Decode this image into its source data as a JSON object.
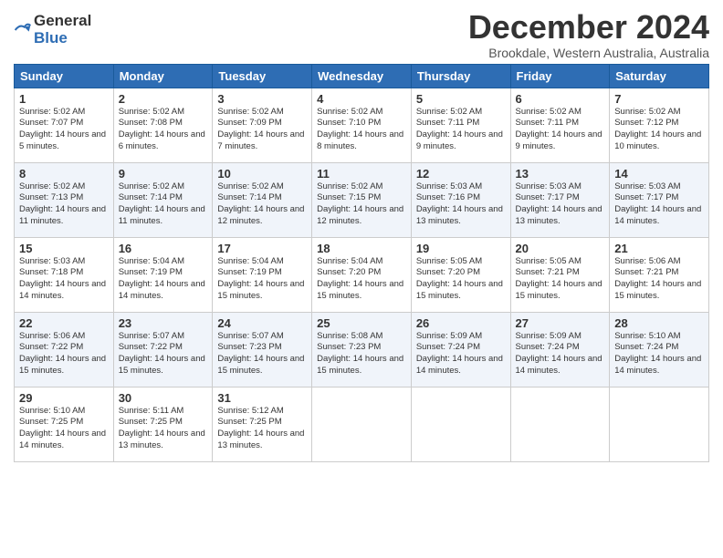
{
  "header": {
    "logo_line1": "General",
    "logo_line2": "Blue",
    "title": "December 2024",
    "subtitle": "Brookdale, Western Australia, Australia"
  },
  "days_of_week": [
    "Sunday",
    "Monday",
    "Tuesday",
    "Wednesday",
    "Thursday",
    "Friday",
    "Saturday"
  ],
  "weeks": [
    [
      {
        "day": "1",
        "sunrise": "5:02 AM",
        "sunset": "7:07 PM",
        "daylight": "14 hours and 5 minutes."
      },
      {
        "day": "2",
        "sunrise": "5:02 AM",
        "sunset": "7:08 PM",
        "daylight": "14 hours and 6 minutes."
      },
      {
        "day": "3",
        "sunrise": "5:02 AM",
        "sunset": "7:09 PM",
        "daylight": "14 hours and 7 minutes."
      },
      {
        "day": "4",
        "sunrise": "5:02 AM",
        "sunset": "7:10 PM",
        "daylight": "14 hours and 8 minutes."
      },
      {
        "day": "5",
        "sunrise": "5:02 AM",
        "sunset": "7:11 PM",
        "daylight": "14 hours and 9 minutes."
      },
      {
        "day": "6",
        "sunrise": "5:02 AM",
        "sunset": "7:11 PM",
        "daylight": "14 hours and 9 minutes."
      },
      {
        "day": "7",
        "sunrise": "5:02 AM",
        "sunset": "7:12 PM",
        "daylight": "14 hours and 10 minutes."
      }
    ],
    [
      {
        "day": "8",
        "sunrise": "5:02 AM",
        "sunset": "7:13 PM",
        "daylight": "14 hours and 11 minutes."
      },
      {
        "day": "9",
        "sunrise": "5:02 AM",
        "sunset": "7:14 PM",
        "daylight": "14 hours and 11 minutes."
      },
      {
        "day": "10",
        "sunrise": "5:02 AM",
        "sunset": "7:14 PM",
        "daylight": "14 hours and 12 minutes."
      },
      {
        "day": "11",
        "sunrise": "5:02 AM",
        "sunset": "7:15 PM",
        "daylight": "14 hours and 12 minutes."
      },
      {
        "day": "12",
        "sunrise": "5:03 AM",
        "sunset": "7:16 PM",
        "daylight": "14 hours and 13 minutes."
      },
      {
        "day": "13",
        "sunrise": "5:03 AM",
        "sunset": "7:17 PM",
        "daylight": "14 hours and 13 minutes."
      },
      {
        "day": "14",
        "sunrise": "5:03 AM",
        "sunset": "7:17 PM",
        "daylight": "14 hours and 14 minutes."
      }
    ],
    [
      {
        "day": "15",
        "sunrise": "5:03 AM",
        "sunset": "7:18 PM",
        "daylight": "14 hours and 14 minutes."
      },
      {
        "day": "16",
        "sunrise": "5:04 AM",
        "sunset": "7:19 PM",
        "daylight": "14 hours and 14 minutes."
      },
      {
        "day": "17",
        "sunrise": "5:04 AM",
        "sunset": "7:19 PM",
        "daylight": "14 hours and 15 minutes."
      },
      {
        "day": "18",
        "sunrise": "5:04 AM",
        "sunset": "7:20 PM",
        "daylight": "14 hours and 15 minutes."
      },
      {
        "day": "19",
        "sunrise": "5:05 AM",
        "sunset": "7:20 PM",
        "daylight": "14 hours and 15 minutes."
      },
      {
        "day": "20",
        "sunrise": "5:05 AM",
        "sunset": "7:21 PM",
        "daylight": "14 hours and 15 minutes."
      },
      {
        "day": "21",
        "sunrise": "5:06 AM",
        "sunset": "7:21 PM",
        "daylight": "14 hours and 15 minutes."
      }
    ],
    [
      {
        "day": "22",
        "sunrise": "5:06 AM",
        "sunset": "7:22 PM",
        "daylight": "14 hours and 15 minutes."
      },
      {
        "day": "23",
        "sunrise": "5:07 AM",
        "sunset": "7:22 PM",
        "daylight": "14 hours and 15 minutes."
      },
      {
        "day": "24",
        "sunrise": "5:07 AM",
        "sunset": "7:23 PM",
        "daylight": "14 hours and 15 minutes."
      },
      {
        "day": "25",
        "sunrise": "5:08 AM",
        "sunset": "7:23 PM",
        "daylight": "14 hours and 15 minutes."
      },
      {
        "day": "26",
        "sunrise": "5:09 AM",
        "sunset": "7:24 PM",
        "daylight": "14 hours and 14 minutes."
      },
      {
        "day": "27",
        "sunrise": "5:09 AM",
        "sunset": "7:24 PM",
        "daylight": "14 hours and 14 minutes."
      },
      {
        "day": "28",
        "sunrise": "5:10 AM",
        "sunset": "7:24 PM",
        "daylight": "14 hours and 14 minutes."
      }
    ],
    [
      {
        "day": "29",
        "sunrise": "5:10 AM",
        "sunset": "7:25 PM",
        "daylight": "14 hours and 14 minutes."
      },
      {
        "day": "30",
        "sunrise": "5:11 AM",
        "sunset": "7:25 PM",
        "daylight": "14 hours and 13 minutes."
      },
      {
        "day": "31",
        "sunrise": "5:12 AM",
        "sunset": "7:25 PM",
        "daylight": "14 hours and 13 minutes."
      },
      null,
      null,
      null,
      null
    ]
  ]
}
